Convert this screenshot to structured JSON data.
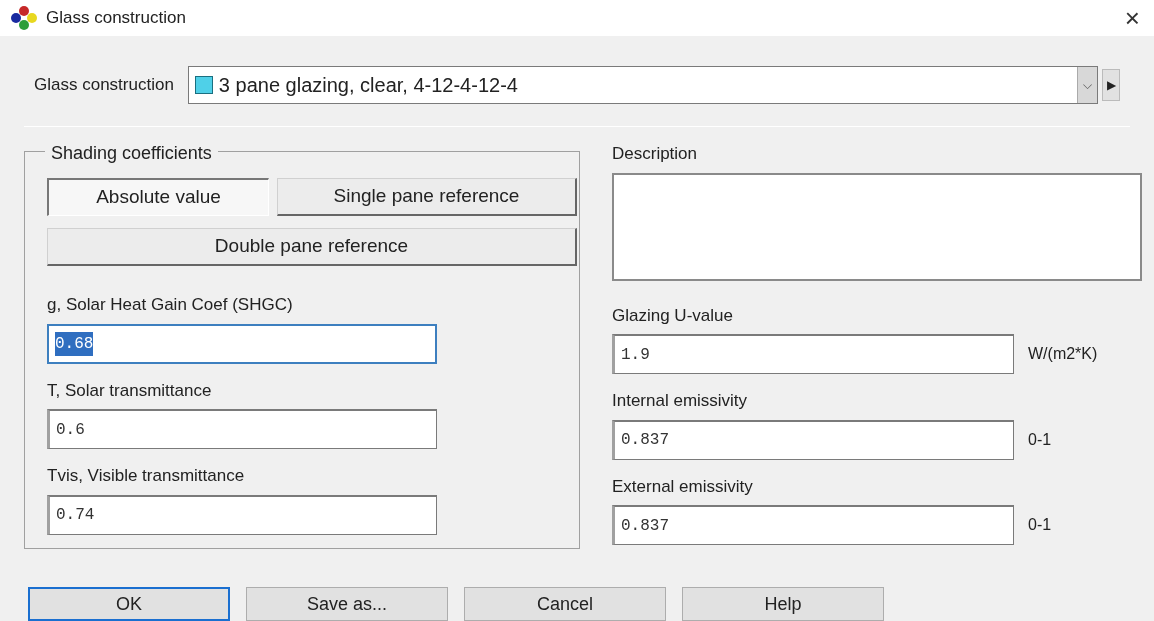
{
  "window": {
    "title": "Glass construction",
    "close": "×"
  },
  "construction": {
    "label": "Glass construction",
    "value": "3 pane glazing, clear, 4-12-4-12-4",
    "dropdown": "⌵",
    "next": "▶"
  },
  "shading": {
    "legend": "Shading coefficients",
    "options": [
      {
        "label": "Absolute value",
        "selected": true
      },
      {
        "label": "Single pane reference",
        "selected": false
      },
      {
        "label": "Double pane reference",
        "selected": false
      }
    ],
    "fields": [
      {
        "label": "g, Solar Heat Gain Coef (SHGC)",
        "value": "0.68",
        "focused": true
      },
      {
        "label": "T, Solar transmittance",
        "value": "0.6",
        "focused": false
      },
      {
        "label": "Tvis, Visible transmittance",
        "value": "0.74",
        "focused": false
      }
    ]
  },
  "description": {
    "label": "Description"
  },
  "properties": [
    {
      "label": "Glazing U-value",
      "value": "1.9",
      "unit": "W/(m2*K)"
    },
    {
      "label": "Internal emissivity",
      "value": "0.837",
      "unit": "0-1"
    },
    {
      "label": "External emissivity",
      "value": "0.837",
      "unit": "0-1"
    }
  ],
  "buttons": [
    {
      "label": "OK",
      "default": true
    },
    {
      "label": "Save as...",
      "default": false
    },
    {
      "label": "Cancel",
      "default": false
    },
    {
      "label": "Help",
      "default": false
    }
  ]
}
